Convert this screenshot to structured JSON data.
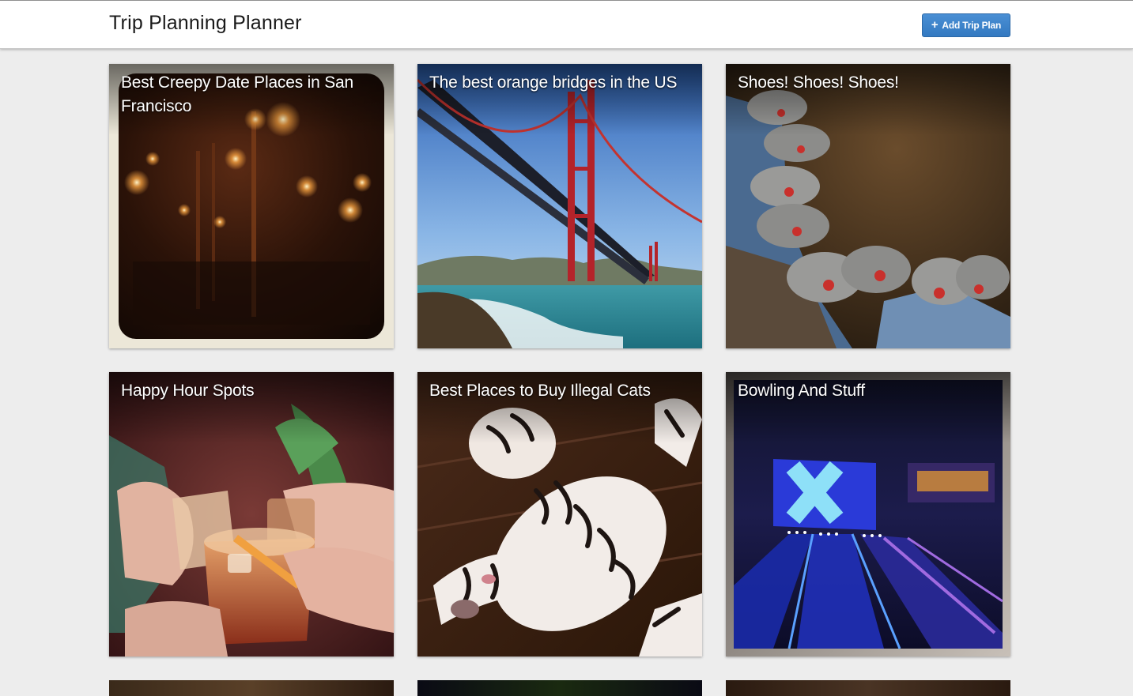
{
  "app": {
    "title": "Trip Planning Planner"
  },
  "toolbar": {
    "add_icon": "plus-icon",
    "add_label": "Add Trip Plan"
  },
  "colors": {
    "accent": "#3a82c8",
    "page_background": "#ededed",
    "navbar_background": "#ffffff"
  },
  "trips": [
    {
      "title": "Best Creepy Date Places in San Francisco",
      "image": "dim restaurant interior with candle-like lights"
    },
    {
      "title": "The best orange bridges in the US",
      "image": "golden gate bridge over the bay"
    },
    {
      "title": "Shoes! Shoes! Shoes!",
      "image": "bowling shoes on the floor"
    },
    {
      "title": "Happy Hour Spots",
      "image": "hands toasting cocktail glasses"
    },
    {
      "title": "Best Places to Buy Illegal Cats",
      "image": "tiger cub lying on wooden floor"
    },
    {
      "title": "Bowling And Stuff",
      "image": "neon-lit bowling alley lanes"
    }
  ]
}
